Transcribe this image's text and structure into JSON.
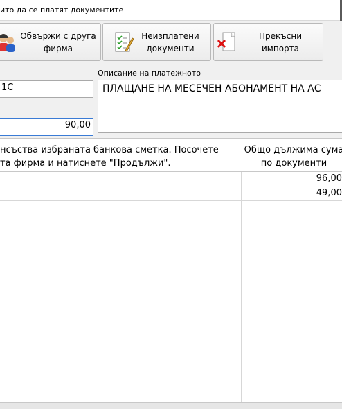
{
  "window": {
    "title": "ито да се платят документите"
  },
  "toolbar": {
    "link_company_label": "Обвържи с друга\nфирма",
    "unpaid_docs_label": "Неизплатени\nдокументи",
    "cancel_import_label": "Прекъсни\nимпорта"
  },
  "form": {
    "account_field_value": "1С",
    "amount_field_value": "90,00",
    "description_label": "Описание на платежното",
    "description_value": "ПЛАЩАНЕ НА МЕСЕЧЕН АБОНАМЕНТ НА АС"
  },
  "grid": {
    "message_header_line1": "нсъства избраната банкова сметка. Посочете",
    "message_header_line2": "та фирма и натиснете \"Продължи\".",
    "amount_header_line1": "Общо дължима сума",
    "amount_header_line2": "по документи",
    "rows": [
      {
        "amount": "96,00"
      },
      {
        "amount": "49,00"
      }
    ]
  },
  "colors": {
    "focus_border": "#3a7bd5",
    "toolbar_bg": "#f0f0f0"
  }
}
